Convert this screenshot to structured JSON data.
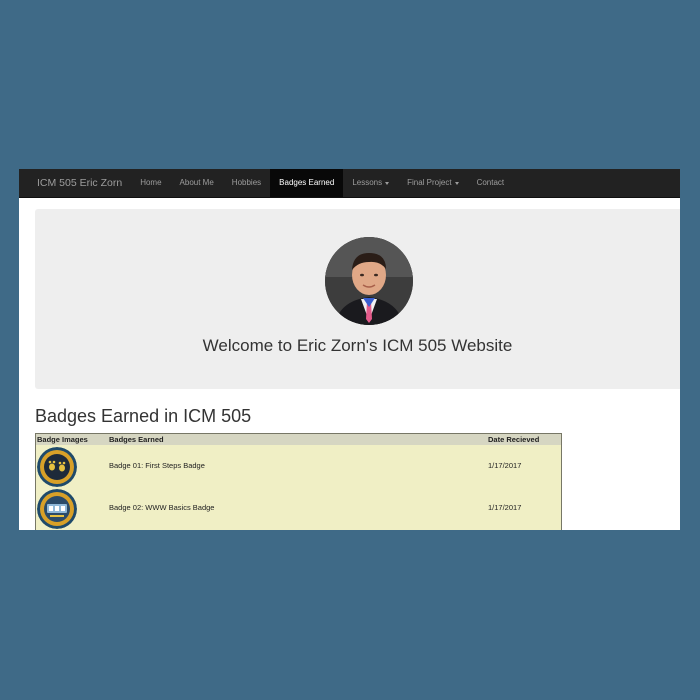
{
  "navbar": {
    "brand": "ICM 505 Eric Zorn",
    "items": [
      {
        "label": "Home"
      },
      {
        "label": "About Me"
      },
      {
        "label": "Hobbies"
      },
      {
        "label": "Badges Earned"
      },
      {
        "label": "Lessons"
      },
      {
        "label": "Final Project"
      },
      {
        "label": "Contact"
      }
    ],
    "active": "Badges Earned"
  },
  "jumbotron": {
    "welcome": "Welcome to Eric Zorn's ICM 505 Website"
  },
  "badges": {
    "heading": "Badges Earned in ICM 505",
    "columns": [
      "Badge Images",
      "Badges Earned",
      "Date Recieved"
    ],
    "rows": [
      {
        "name": "Badge 01: First Steps Badge",
        "date": "1/17/2017",
        "icon": "paw-prints-badge-icon"
      },
      {
        "name": "Badge 02: WWW Basics Badge",
        "date": "1/17/2017",
        "icon": "www-basics-badge-icon"
      }
    ]
  },
  "colors": {
    "page_background": "#3f6a87",
    "navbar": "#222222",
    "navbar_active": "#080808",
    "jumbotron": "#eeeeee",
    "table_background": "#f0efc5",
    "table_header": "#d6d6c2"
  }
}
